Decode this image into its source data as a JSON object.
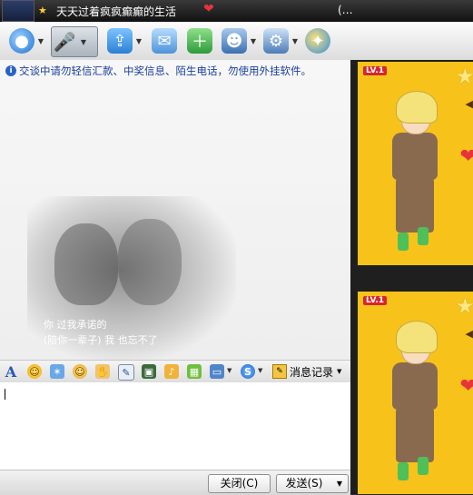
{
  "titlebar": {
    "title_partial": "一 ' ' — ' ' ' '",
    "id_partial": "(",
    "paren": "(…",
    "signature": "天天过着疯疯癫癫的生活"
  },
  "icons": {
    "status": "star-icon",
    "mood": "heart-icon",
    "video": "camera-icon",
    "voice": "microphone-icon",
    "file": "folder-transfer-icon",
    "mail": "mail-icon",
    "add": "add-contact-icon",
    "user": "user-icon",
    "apps": "apps-icon",
    "world": "globe-icon"
  },
  "chat": {
    "notice": "交谈中请勿轻信汇款、中奖信息、陌生电话，勿使用外挂软件。",
    "lyric_line1": "你   过我承诺的",
    "lyric_line2": "(陪你一辈子)  我       也忘不了"
  },
  "formatbar": {
    "font_glyph": "A",
    "history_label": "消息记录"
  },
  "buttons": {
    "close": "关闭(C)",
    "send": "发送(S)"
  },
  "sidepanel": {
    "show1_level": "LV.1",
    "show2_level": "LV.1"
  },
  "colors": {
    "show_bg": "#f7c31b",
    "notice_text": "#1b3f99",
    "heart": "#e8333b"
  }
}
